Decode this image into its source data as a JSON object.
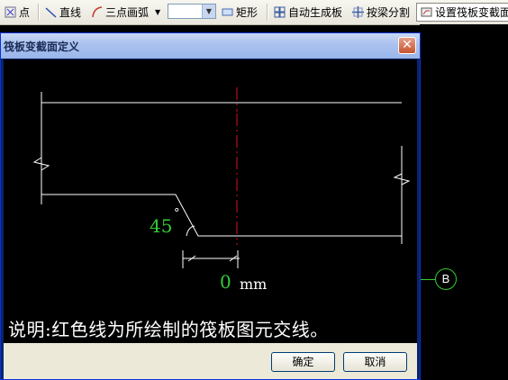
{
  "toolbar": {
    "items": [
      {
        "label": "点",
        "icon": "point-icon"
      },
      {
        "label": "直线",
        "icon": "line-icon"
      },
      {
        "label": "三点画弧",
        "icon": "arc-icon"
      },
      {
        "label": "矩形",
        "icon": "rectangle-icon"
      },
      {
        "label": "自动生成板",
        "icon": "auto-slab-icon"
      },
      {
        "label": "按梁分割",
        "icon": "split-by-beam-icon"
      },
      {
        "label": "设置筏板变截面",
        "icon": "set-raft-section-icon"
      }
    ],
    "dropdown_value": ""
  },
  "dialog": {
    "title": "筏板变截面定义",
    "angle_value": "45",
    "degree_symbol": "°",
    "offset_value": "0",
    "offset_unit": "mm",
    "note": "说明:红色线为所绘制的筏板图元交线。",
    "ok_label": "确定",
    "cancel_label": "取消",
    "close_glyph": "✕"
  },
  "axis": {
    "label": "B"
  },
  "colors": {
    "title_bg": "#a9c1ee",
    "red_line": "#e01010",
    "value_green": "#33cc33",
    "axis_green": "#33cc33"
  }
}
